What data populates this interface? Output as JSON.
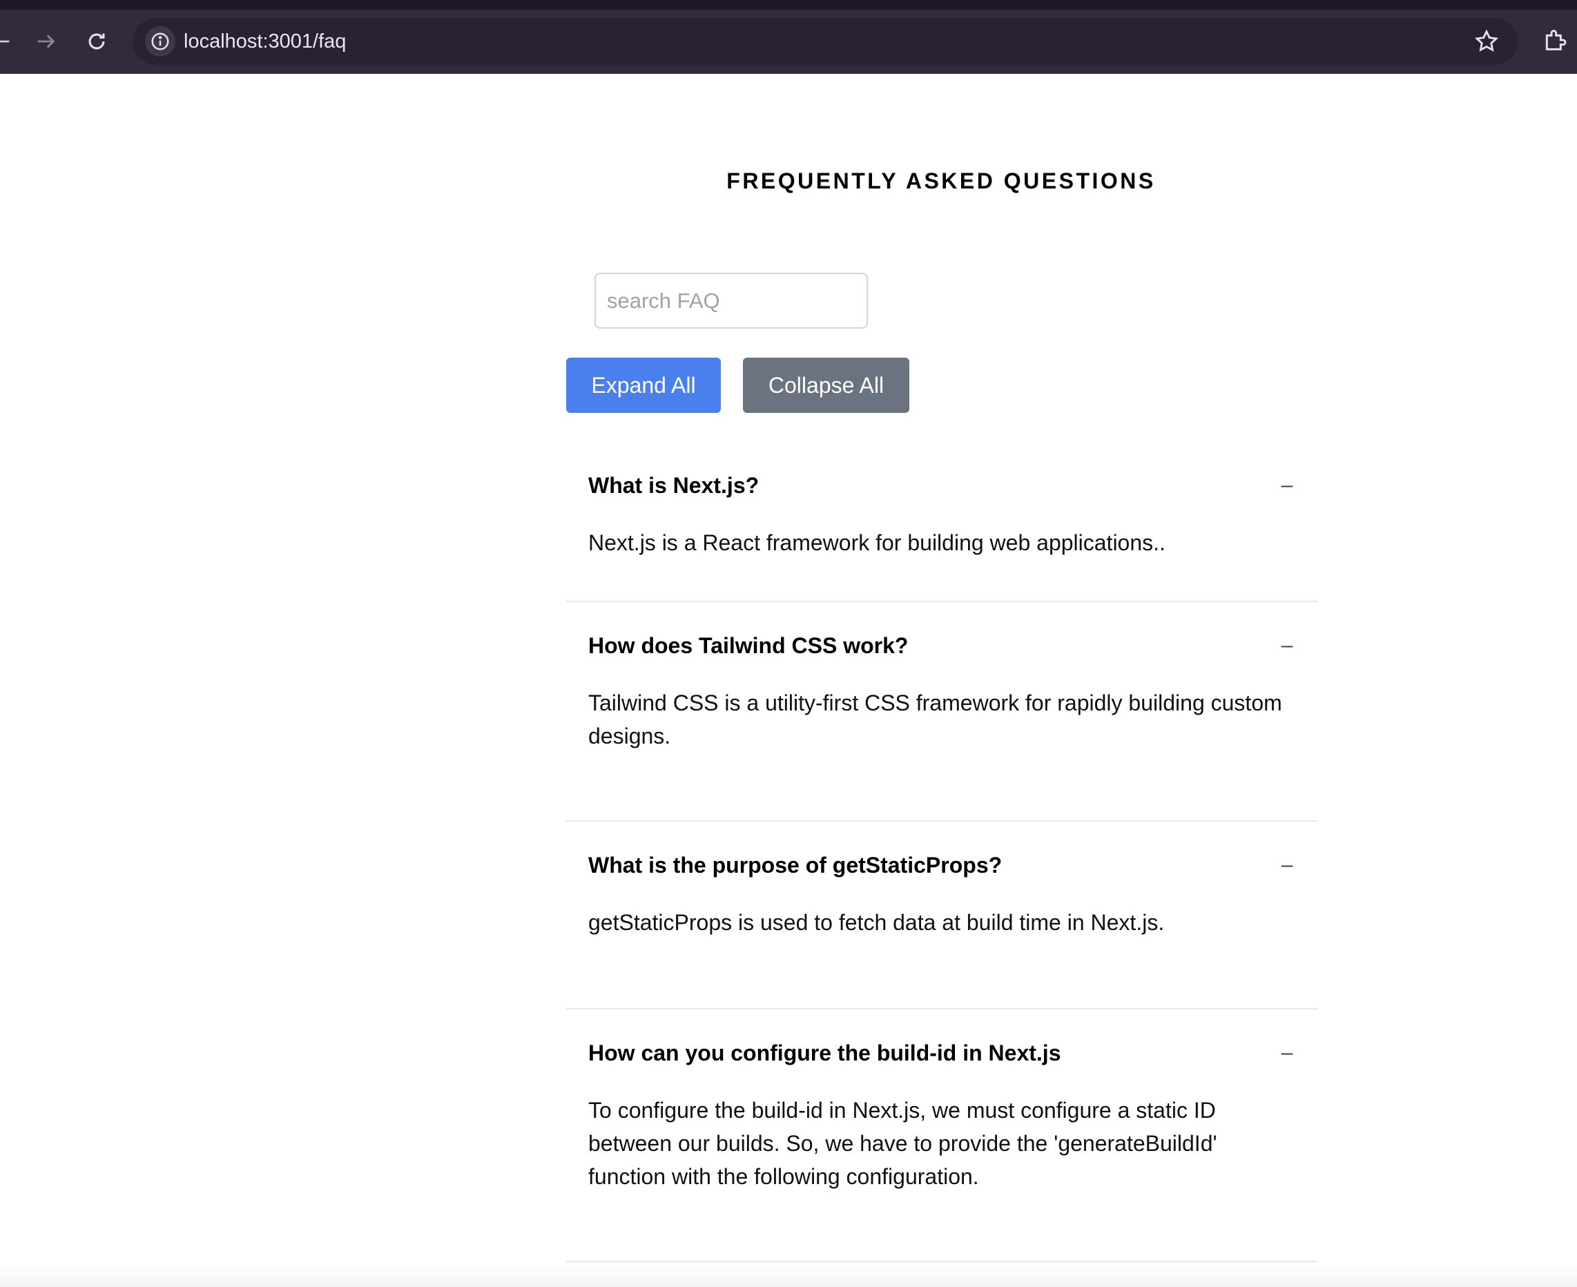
{
  "browser": {
    "url": "localhost:3001/faq",
    "icons": [
      "back-arrow-icon",
      "forward-arrow-icon",
      "reload-icon",
      "info-icon",
      "star-icon",
      "extensions-icon"
    ]
  },
  "page": {
    "title": "FREQUENTLY ASKED QUESTIONS",
    "search": {
      "placeholder": "search FAQ",
      "value": ""
    },
    "expand_label": "Expand All",
    "collapse_label": "Collapse All",
    "toggle_symbol": "–",
    "faqs": [
      {
        "question": "What is Next.js?",
        "answer": "Next.js is a React framework for building web applications.."
      },
      {
        "question": "How does Tailwind CSS work?",
        "answer": "Tailwind CSS is a utility-first CSS framework for rapidly building custom designs."
      },
      {
        "question": "What is the purpose of getStaticProps?",
        "answer": "getStaticProps is used to fetch data at build time in Next.js."
      },
      {
        "question": "How can you configure the build-id in Next.js",
        "answer": "To configure the build-id in Next.js, we must configure a static ID between our builds. So, we have to provide the 'generateBuildId' function with the following configuration."
      }
    ]
  },
  "colors": {
    "chrome": "#322a3d",
    "expand_button": "#4a80ee",
    "collapse_button": "#6b7280"
  }
}
